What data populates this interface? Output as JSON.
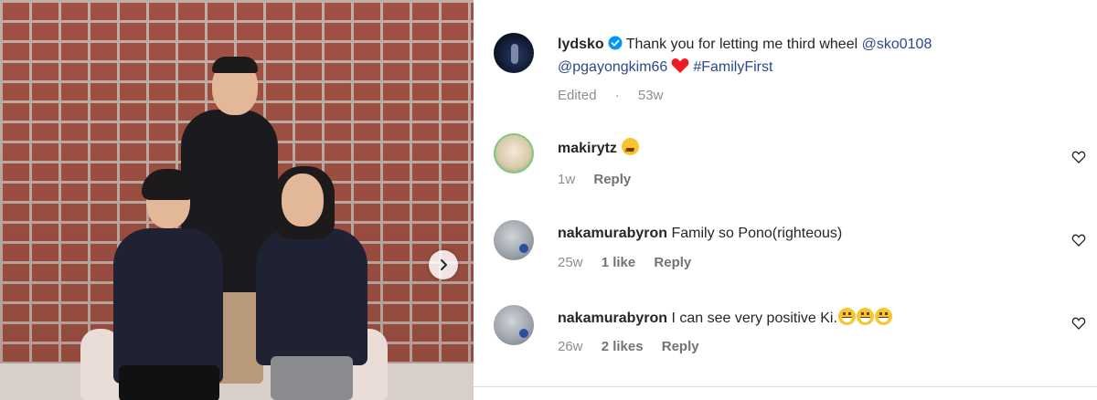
{
  "photo": {
    "alt_icon": "photo-of-three-people",
    "next_icon": "chevron-right-icon"
  },
  "post": {
    "username": "lydsko",
    "verified_icon": "verified-badge-icon",
    "caption_text": "Thank you for letting me third wheel",
    "mention_1": "@sko0108",
    "mention_2": "@pgayongkim66",
    "heart_icon": "red-heart-emoji",
    "hashtag": "#FamilyFirst",
    "edited_label": "Edited",
    "separator": "·",
    "age": "53w"
  },
  "comments": [
    {
      "username": "makirytz",
      "text": "",
      "emoji": [
        "star-struck-emoji"
      ],
      "age": "1w",
      "likes": "",
      "reply_label": "Reply",
      "like_icon": "heart-outline-icon"
    },
    {
      "username": "nakamurabyron",
      "text": "Family so Pono(righteous)",
      "emoji": [],
      "age": "25w",
      "likes": "1 like",
      "reply_label": "Reply",
      "like_icon": "heart-outline-icon"
    },
    {
      "username": "nakamurabyron",
      "text": "I can see very positive Ki.",
      "emoji": [
        "grinning-emoji",
        "grinning-emoji",
        "grinning-emoji"
      ],
      "age": "26w",
      "likes": "2 likes",
      "reply_label": "Reply",
      "like_icon": "heart-outline-icon"
    }
  ],
  "colors": {
    "text": "#262626",
    "meta": "#8e8e8e",
    "link": "#2a4a8a",
    "verified": "#0095f6",
    "heart": "#ed1c24"
  }
}
